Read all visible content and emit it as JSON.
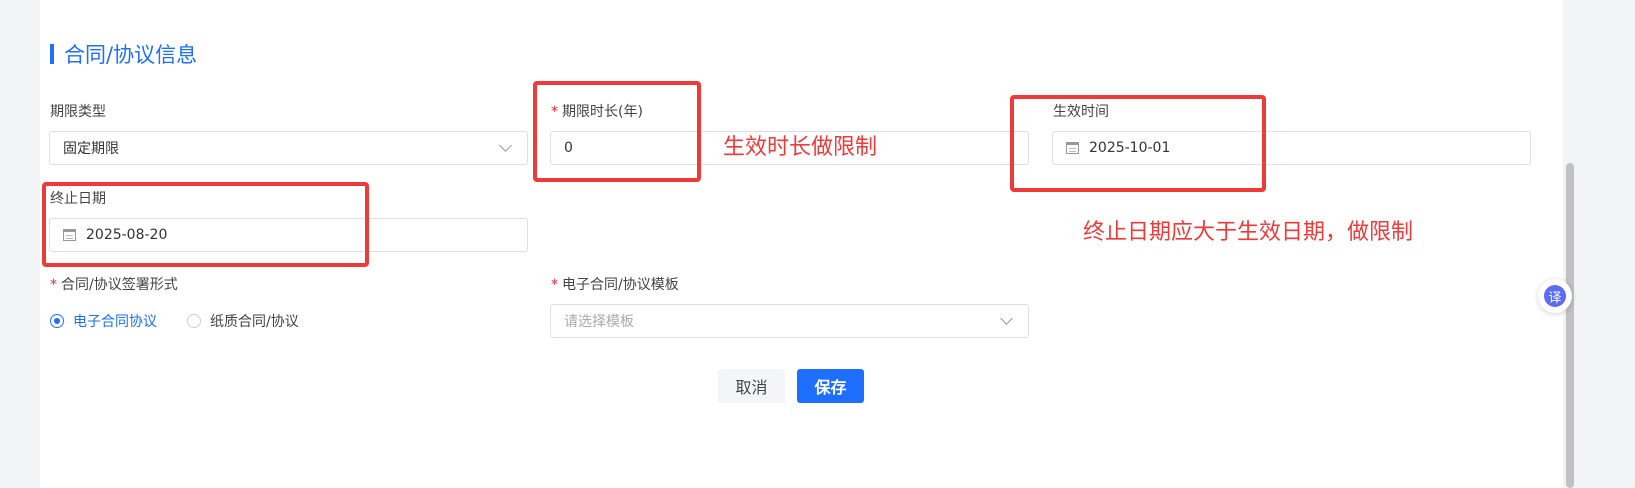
{
  "section": {
    "title": "合同/协议信息"
  },
  "fields": {
    "term_type": {
      "label": "期限类型",
      "value": "固定期限"
    },
    "term_length": {
      "required": "*",
      "label": "期限时长(年)",
      "value": "0"
    },
    "effective_date": {
      "label": "生效时间",
      "value": "2025-10-01"
    },
    "end_date": {
      "label": "终止日期",
      "value": "2025-08-20"
    },
    "sign_form": {
      "required": "*",
      "label": "合同/协议签署形式",
      "options": [
        "电子合同协议",
        "纸质合同/协议"
      ],
      "selected": "电子合同协议"
    },
    "template": {
      "required": "*",
      "label": "电子合同/协议模板",
      "placeholder": "请选择模板"
    }
  },
  "annotations": {
    "note_1": "生效时长做限制",
    "note_2": "终止日期应大于生效日期，做限制",
    "color": "#ef3a3a"
  },
  "buttons": {
    "cancel": "取消",
    "save": "保存"
  },
  "translate_fab": {
    "label": "译",
    "icon": "translate-icon"
  },
  "colors": {
    "primary": "#1e6fff",
    "required": "#f5222d"
  }
}
